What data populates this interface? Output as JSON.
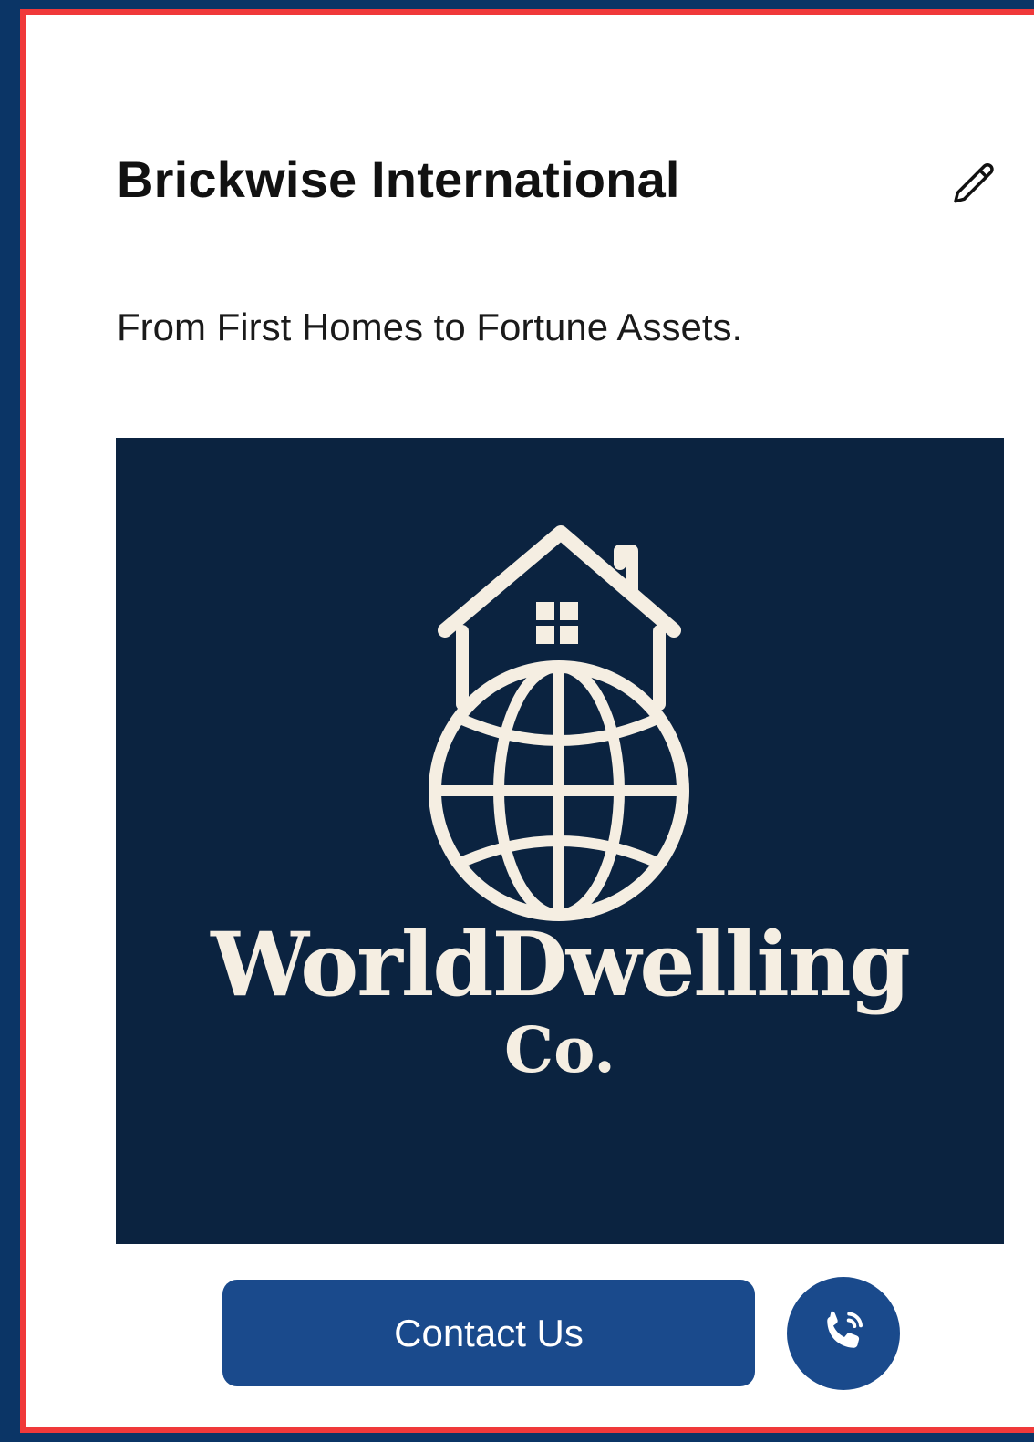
{
  "card": {
    "title": "Brickwise International",
    "tagline": "From First Homes to Fortune Assets.",
    "edit_icon": "pencil-icon"
  },
  "logo": {
    "name": "WorldDwelling",
    "suffix": "Co.",
    "icon": "house-on-globe",
    "background_color": "#0b2340",
    "foreground_color": "#f5eee2"
  },
  "actions": {
    "contact_label": "Contact Us",
    "call_icon": "phone-ringing-icon"
  },
  "colors": {
    "page_background": "#0b3566",
    "frame_border": "#f0393a",
    "button_primary": "#1a4a8c"
  }
}
